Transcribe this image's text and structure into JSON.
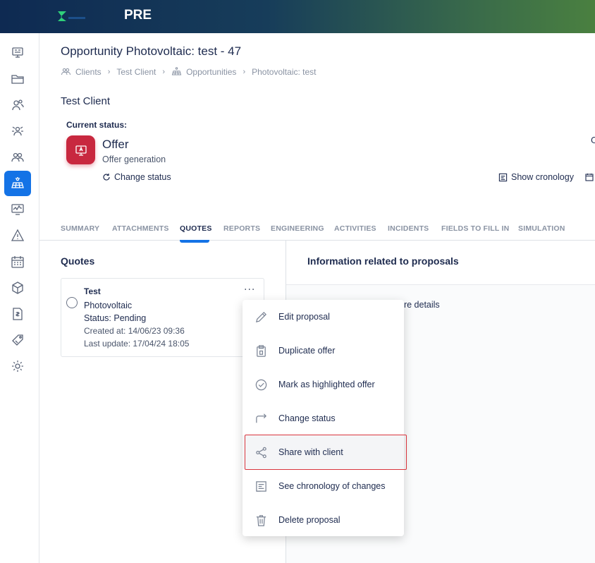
{
  "header": {
    "env_label": "PRE",
    "brand_color": "#1473e6"
  },
  "sidebar": {
    "items": [
      {
        "icon": "dashboard-icon"
      },
      {
        "icon": "folder-icon"
      },
      {
        "icon": "clients-icon"
      },
      {
        "icon": "network-icon"
      },
      {
        "icon": "contacts-icon"
      },
      {
        "icon": "solar-panel-icon",
        "active": true
      },
      {
        "icon": "monitoring-icon"
      },
      {
        "icon": "warning-icon"
      },
      {
        "icon": "calendar-icon"
      },
      {
        "icon": "box-icon"
      },
      {
        "icon": "invoice-icon"
      },
      {
        "icon": "tag-icon"
      },
      {
        "icon": "settings-icon"
      }
    ]
  },
  "page": {
    "title": "Opportunity Photovoltaic: test - 47",
    "breadcrumb": [
      "Clients",
      "Test Client",
      "Opportunities",
      "Photovoltaic: test"
    ],
    "client_name": "Test Client",
    "current_status_label": "Current status:",
    "status_name": "Offer",
    "status_sub": "Offer generation",
    "status_color": "#c8283f",
    "change_status": "Change status",
    "show_cronology": "Show cronology",
    "cut_text": "C"
  },
  "tabs": [
    "SUMMARY",
    "ATTACHMENTS",
    "QUOTES",
    "REPORTS",
    "ENGINEERING",
    "ACTIVITIES",
    "INCIDENTS",
    "FIELDS TO FILL IN",
    "SIMULATION"
  ],
  "active_tab": "QUOTES",
  "quotes": {
    "heading": "Quotes",
    "card": {
      "title": "Test",
      "type": "Photovoltaic",
      "status": "Status:  Pending",
      "created": "Created at:  14/06/23 09:36",
      "updated": "Last update:  17/04/24 18:05",
      "more": "···"
    }
  },
  "info": {
    "heading": "Information related to proposals",
    "partial_text": "ore details"
  },
  "menu": {
    "items": [
      {
        "label": "Edit proposal",
        "icon": "pencil-icon"
      },
      {
        "label": "Duplicate offer",
        "icon": "clipboard-icon"
      },
      {
        "label": "Mark as highlighted offer",
        "icon": "check-circle-icon"
      },
      {
        "label": "Change status",
        "icon": "redirect-arrow-icon"
      },
      {
        "label": "Share with client",
        "icon": "share-icon",
        "highlighted": true
      },
      {
        "label": "See chronology of changes",
        "icon": "history-list-icon"
      },
      {
        "label": "Delete proposal",
        "icon": "trash-icon"
      }
    ]
  }
}
